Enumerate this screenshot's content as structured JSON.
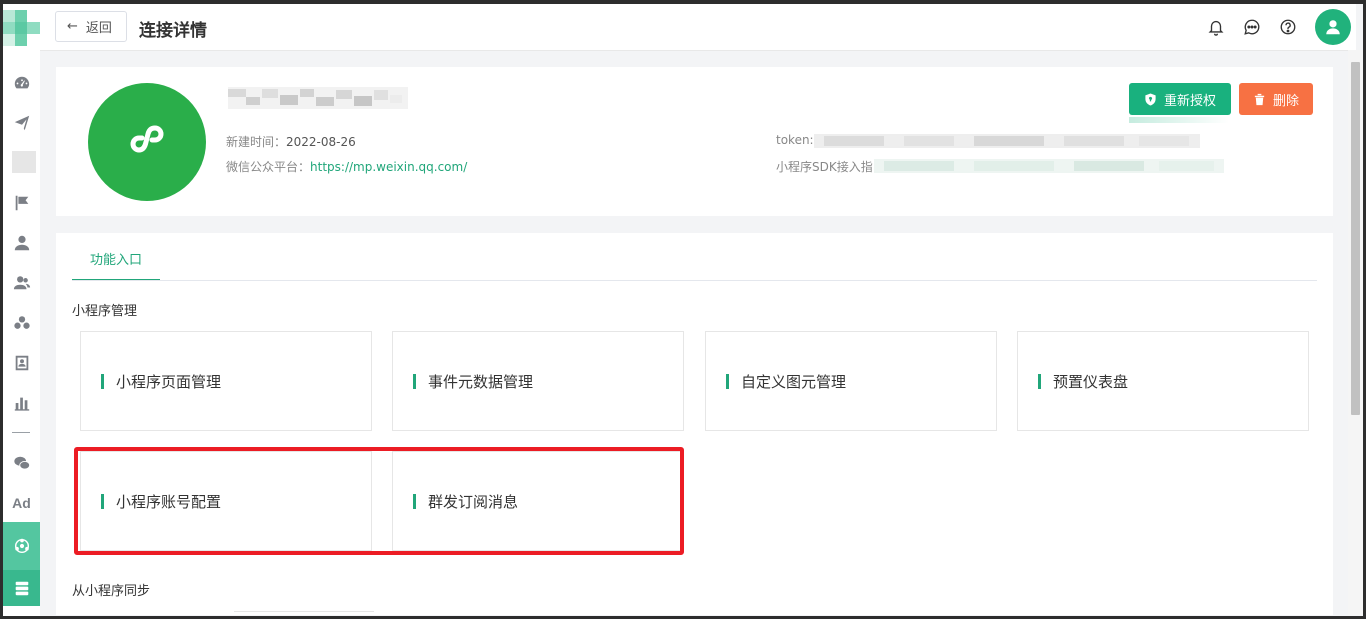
{
  "header": {
    "back_label": "返回",
    "back_arrow": "←",
    "title": "连接详情",
    "icons": [
      "bell-icon",
      "chat-icon",
      "help-icon",
      "user-icon"
    ]
  },
  "sidebar": {
    "items": [
      "dashboard-icon",
      "send-icon",
      "flag-icon",
      "user-icon",
      "users-icon",
      "group-icon",
      "contact-icon",
      "bar-chart-icon",
      "wechat-icon",
      "ad-icon",
      "miniprogram-icon",
      "server-icon"
    ],
    "ad_label": "Ad"
  },
  "info": {
    "created_label": "新建时间：",
    "created_value": "2022-08-26",
    "platform_label": "微信公众平台：",
    "platform_url": "https://mp.weixin.qq.com/",
    "token_label": "token:",
    "sdk_label": "小程序SDK接入指",
    "reauth_label": "重新授权",
    "delete_label": "删除"
  },
  "tabs": [
    "功能入口"
  ],
  "sections": {
    "management_title": "小程序管理",
    "sync_title": "从小程序同步"
  },
  "tiles": [
    {
      "label": "小程序页面管理"
    },
    {
      "label": "事件元数据管理"
    },
    {
      "label": "自定义图元管理"
    },
    {
      "label": "预置仪表盘"
    },
    {
      "label": "小程序账号配置"
    },
    {
      "label": "群发订阅消息"
    }
  ],
  "colors": {
    "accent": "#21a67a",
    "danger": "#f77143",
    "highlight": "#ec1c24"
  }
}
